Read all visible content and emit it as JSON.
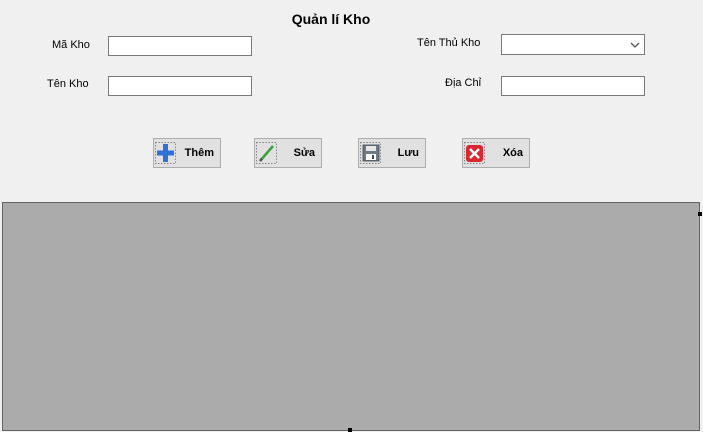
{
  "form": {
    "title": "Quản lí Kho",
    "ma_kho_label": "Mã Kho",
    "ma_kho_value": "",
    "ten_kho_label": "Tên Kho",
    "ten_kho_value": "",
    "ten_thu_kho_label": "Tên Thủ Kho",
    "ten_thu_kho_selected": "",
    "dia_chi_label": "Địa Chỉ",
    "dia_chi_value": ""
  },
  "buttons": {
    "them_label": "Thêm",
    "sua_label": "Sửa",
    "luu_label": "Lưu",
    "xoa_label": "Xóa"
  },
  "icons": {
    "them": "plus-icon",
    "sua": "pencil-icon",
    "luu": "floppy-disk-icon",
    "xoa": "delete-x-icon",
    "combo": "chevron-down-icon"
  },
  "colors": {
    "window_bg": "#f0f0f0",
    "grid_bg": "#ababab",
    "plus_blue": "#2f6fd8",
    "delete_red": "#d9262f",
    "pencil_green": "#3aa33a"
  }
}
